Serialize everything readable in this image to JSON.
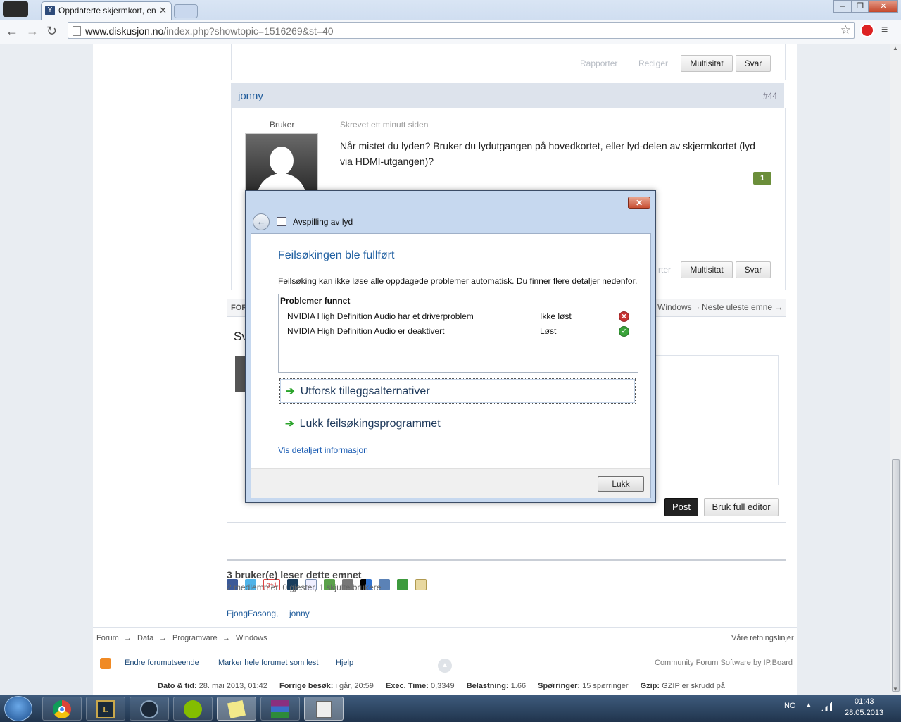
{
  "browser": {
    "tab_title": "Oppdaterte skjermkort, en",
    "url_domain": "www.diskusjon.no",
    "url_rest": "/index.php?showtopic=1516269&st=40"
  },
  "post_top": {
    "actions": {
      "report": "Rapporter",
      "edit": "Rediger",
      "multiquote": "Multisitat",
      "reply": "Svar"
    }
  },
  "post": {
    "author": "jonny",
    "post_number": "#44",
    "role": "Bruker",
    "posted": "Skrevet ett minutt siden",
    "text": "Når mistet du lyden? Bruker du lydutgangen på hovedkortet, eller lyd-delen av skjermkortet (lyd via HDMI-utgangen)?",
    "reputation": "1",
    "actions": {
      "report_partial": "rter",
      "multiquote": "Multisitat",
      "reply": "Svar"
    }
  },
  "topic_nav": {
    "left_partial": "FOR",
    "windows": "Windows",
    "next": "Neste uleste emne →"
  },
  "quick_reply": {
    "title_partial": "Sv",
    "post": "Post",
    "full_editor": "Bruk full editor"
  },
  "readers": {
    "title": "3 bruker(e) leser dette emnet",
    "summary": "2 medlemmer, 0 gjester, 1 skjulte brukere",
    "users": [
      "FjongFasong,",
      "jonny"
    ]
  },
  "breadcrumb": {
    "items": [
      "Forum",
      "Data",
      "Programvare",
      "Windows"
    ],
    "sep": "→",
    "guidelines": "Våre retningslinjer"
  },
  "footer": {
    "links": [
      "Endre forumutseende",
      "Marker hele forumet som lest",
      "Hjelp"
    ],
    "powered": "Community Forum Software by IP.Board",
    "stats": [
      {
        "label": "Dato & tid:",
        "value": "28. mai 2013, 01:42"
      },
      {
        "label": "Forrige besøk:",
        "value": "i går, 20:59"
      },
      {
        "label": "Exec. Time:",
        "value": "0,3349"
      },
      {
        "label": "Belastning:",
        "value": "1.66"
      },
      {
        "label": "Spørringer:",
        "value": "15 spørringer"
      },
      {
        "label": "Gzip:",
        "value": "GZIP er skrudd på"
      }
    ]
  },
  "dialog": {
    "title": "Avspilling av lyd",
    "heading": "Feilsøkingen ble fullført",
    "description": "Feilsøking kan ikke løse alle oppdagede problemer automatisk. Du finner flere detaljer nedenfor.",
    "problems_header": "Problemer funnet",
    "problems": [
      {
        "name": "NVIDIA High Definition Audio har et driverproblem",
        "status": "Ikke løst",
        "icon": "error-icon"
      },
      {
        "name": "NVIDIA High Definition Audio er deaktivert",
        "status": "Løst",
        "icon": "check-icon"
      }
    ],
    "explore": "Utforsk tilleggsalternativer",
    "close_program": "Lukk feilsøkingsprogrammet",
    "details_link": "Vis detaljert informasjon",
    "close_button": "Lukk"
  },
  "taskbar": {
    "language": "NO",
    "time": "01:43",
    "date": "28.05.2013"
  },
  "colors": {
    "accent_link": "#1d5a9a",
    "post_header": "#dde3ec",
    "dialog_heading": "#1e5ea0",
    "dark_button": "#222222"
  }
}
